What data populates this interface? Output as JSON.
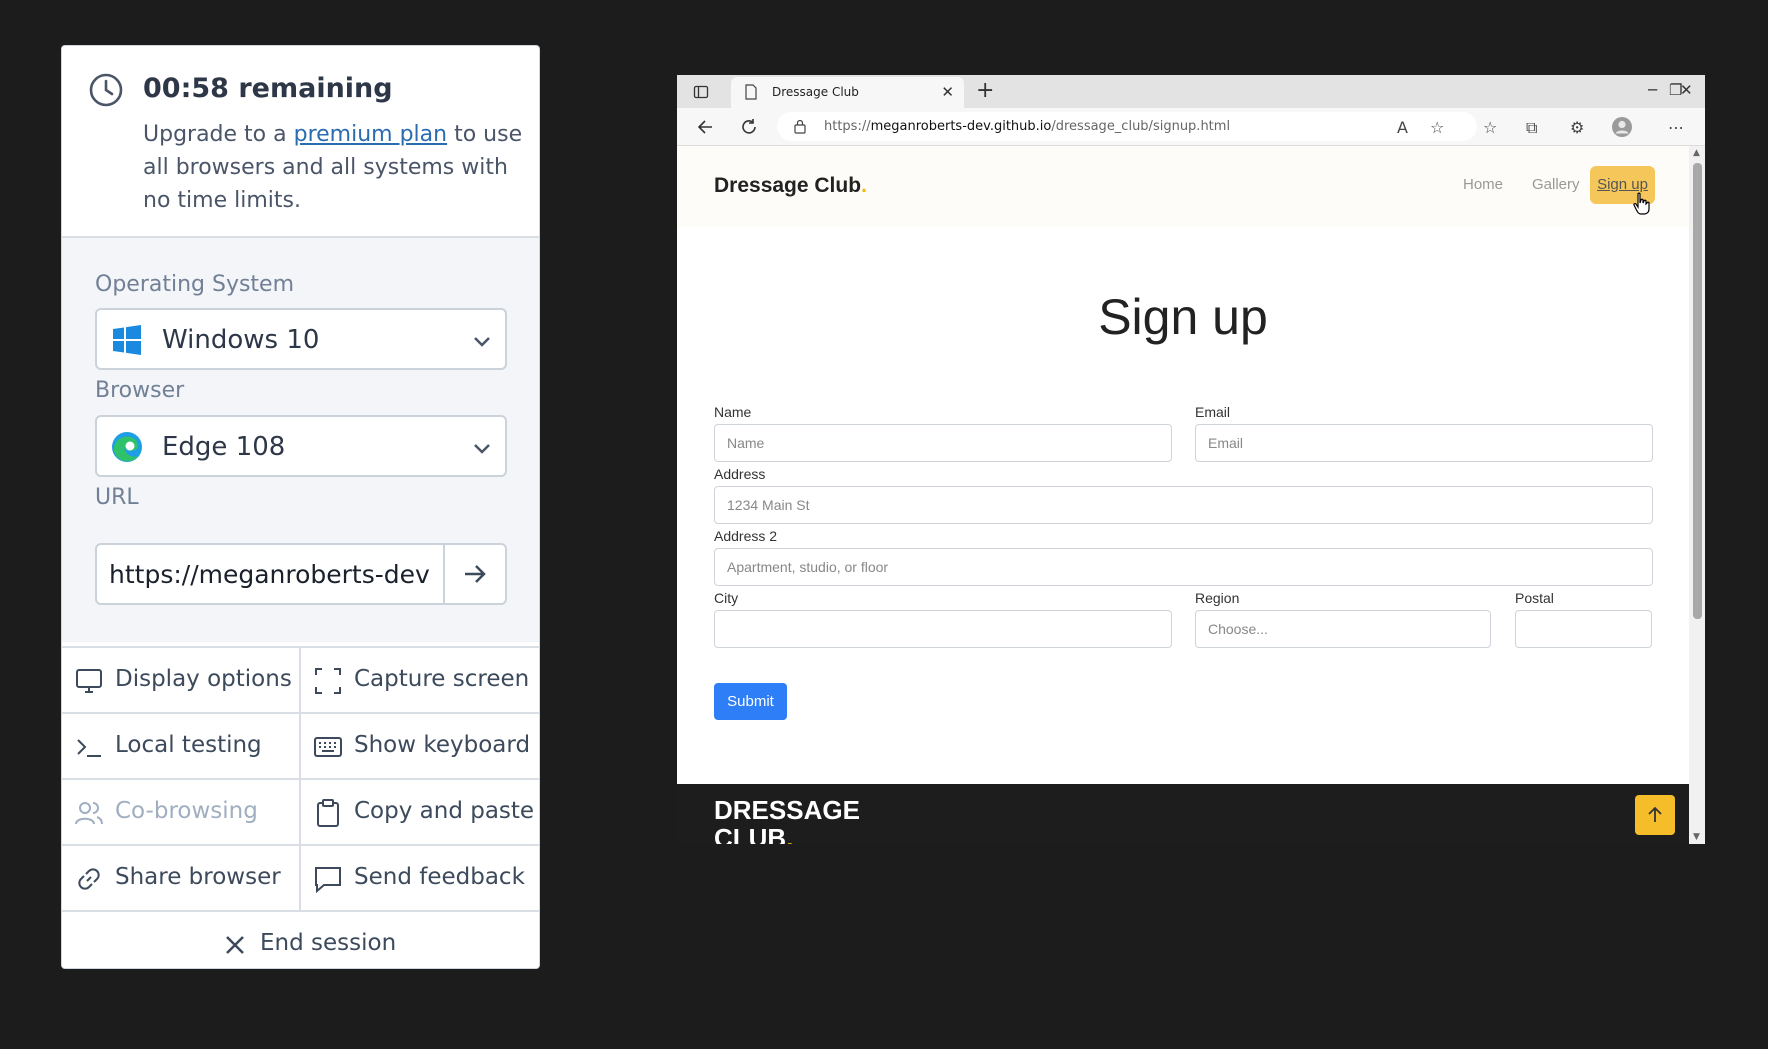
{
  "session": {
    "timer": "00:58 remaining",
    "upgrade_before": "Upgrade to a ",
    "upgrade_link": "premium plan",
    "upgrade_after": " to use all browsers and all systems with no time limits."
  },
  "settings": {
    "os_label": "Operating System",
    "os_value": "Windows 10",
    "browser_label": "Browser",
    "browser_value": "Edge 108",
    "url_label": "URL",
    "url_value": "https://meganroberts-dev.github.io/dressage_club/signup.html"
  },
  "actions": {
    "display_options": "Display options",
    "capture_screen": "Capture screen",
    "local_testing": "Local testing",
    "show_keyboard": "Show keyboard",
    "co_browsing": "Co-browsing",
    "copy_paste": "Copy and paste",
    "share_browser": "Share browser",
    "send_feedback": "Send feedback",
    "end_session": "End session"
  },
  "browser": {
    "tab_title": "Dressage Club",
    "address_prefix": "https://",
    "address_host": "meganroberts-dev.github.io",
    "address_path": "/dressage_club/signup.html"
  },
  "site": {
    "brand": "Dressage Club",
    "nav": [
      "Home",
      "Gallery",
      "Sign up"
    ],
    "heading": "Sign up",
    "labels": {
      "name": "Name",
      "email": "Email",
      "address": "Address",
      "address2": "Address 2",
      "city": "City",
      "region": "Region",
      "postal": "Postal"
    },
    "placeholders": {
      "name": "Name",
      "email": "Email",
      "address": "1234 Main St",
      "address2": "Apartment, studio, or floor",
      "region": "Choose..."
    },
    "submit": "Submit",
    "footer_brand_line1": "DRESSAGE",
    "footer_brand_line2": "CLUB"
  },
  "colors": {
    "accent_yellow": "#f5c75a",
    "submit_blue": "#2d7ef7",
    "link_blue": "#2b6cb0"
  }
}
